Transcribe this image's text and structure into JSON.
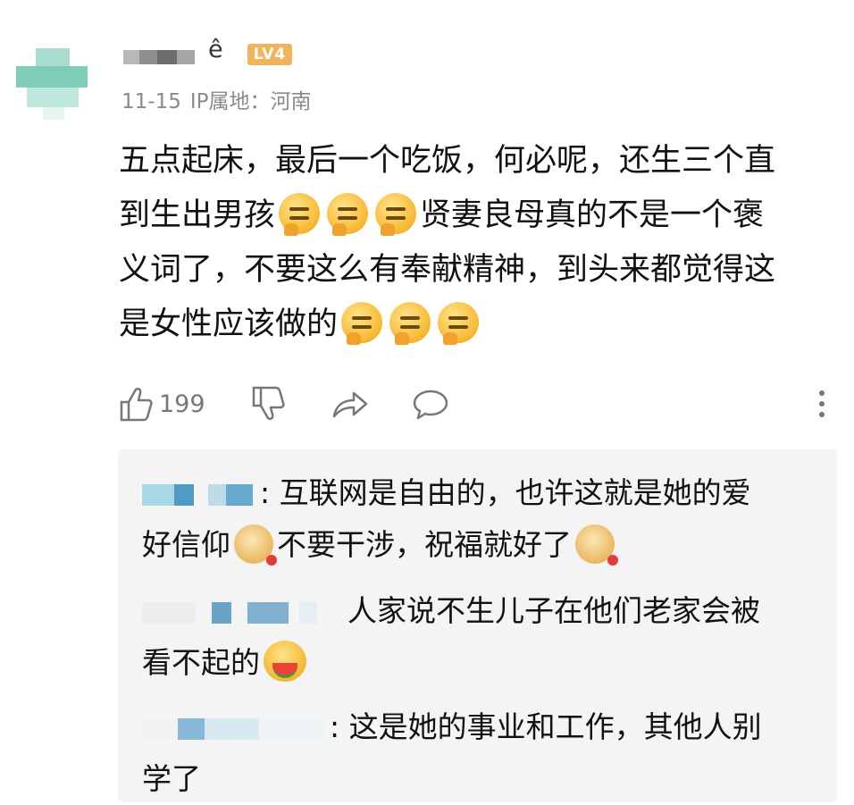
{
  "comment": {
    "user_badge": "LV4",
    "name_glyph": "ê",
    "date": "11-15",
    "ip_location": "IP属地：河南",
    "text_line1": "五点起床，最后一个吃饭，何必呢，还生三个直",
    "text_line2a": "到生出男孩",
    "text_line2b": "贤妻良母真的不是一个褒",
    "text_line3": "义词了，不要这么有奉献精神，到头来都觉得这",
    "text_line4": "是女性应该做的",
    "like_count": "199",
    "emoji_name": "angry-smoking-emoji"
  },
  "replies": [
    {
      "text_line1": ": 互联网是自由的，也许这就是她的爱",
      "text_line2a": "好信仰",
      "text_line2b": "不要干涉，祝福就好了",
      "emoji_name": "doge-rose-emoji"
    },
    {
      "text_line1": "人家说不生儿子在他们老家会被",
      "text_line2": "看不起的",
      "emoji_name": "eating-watermelon-emoji"
    },
    {
      "text_line1": ": 这是她的事业和工作，其他人别",
      "text_line2": "学了"
    }
  ],
  "colors": {
    "badge": "#f0b45c",
    "meta_text": "#8a8a8a",
    "reply_bg": "#f4f4f4",
    "icon_gray": "#777777"
  }
}
